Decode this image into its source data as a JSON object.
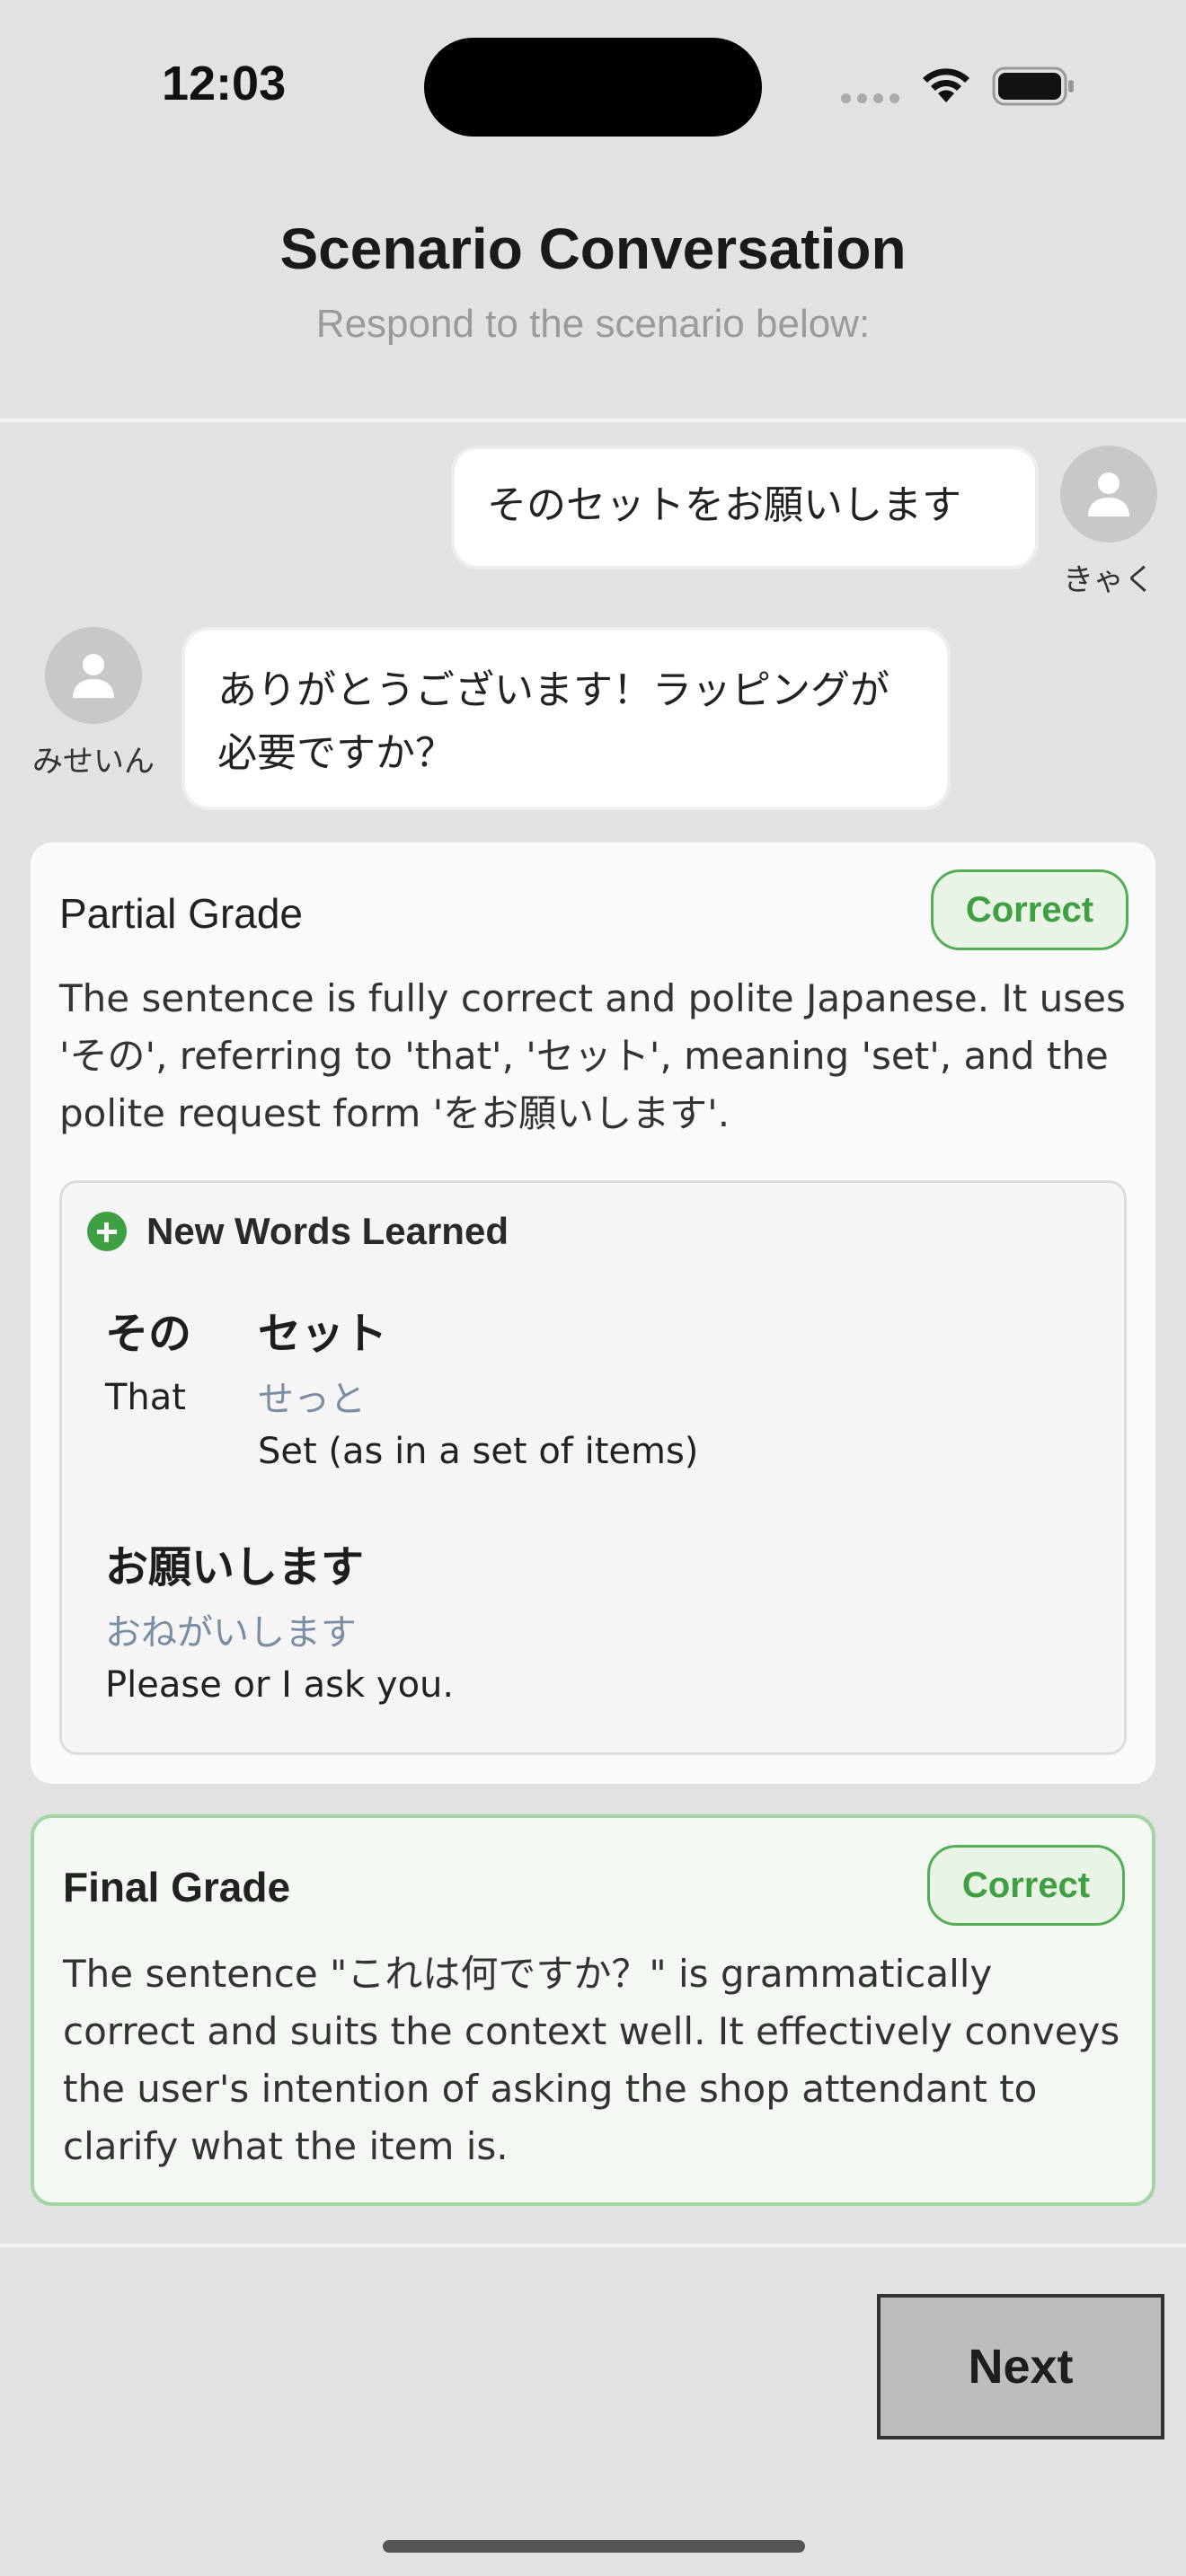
{
  "status": {
    "time": "12:03",
    "icons": [
      "cellular-dots-icon",
      "wifi-icon",
      "battery-icon"
    ]
  },
  "header": {
    "title": "Scenario Conversation",
    "subtitle": "Respond to the scenario below:"
  },
  "conversation": [
    {
      "speaker": "きゃく",
      "text": "そのセットをお願いします",
      "side": "right"
    },
    {
      "speaker": "みせいん",
      "text": "ありがとうございます！ラッピングが必要ですか？",
      "side": "left"
    }
  ],
  "partial_grade": {
    "title": "Partial Grade",
    "badge": "Correct",
    "text": "The sentence is fully correct and polite Japanese. It uses 'その', referring to 'that', 'セット', meaning 'set', and the polite request form 'をお願いします'.",
    "new_words_title": "New Words Learned",
    "words": [
      {
        "word": "その",
        "reading": "",
        "meaning": "That"
      },
      {
        "word": "セット",
        "reading": "せっと",
        "meaning": "Set (as in a set of items)"
      },
      {
        "word": "お願いします",
        "reading": "おねがいします",
        "meaning": "Please or I ask you."
      }
    ]
  },
  "final_grade": {
    "title": "Final Grade",
    "badge": "Correct",
    "text": "The sentence \"これは何ですか？\" is grammatically correct and suits the context well. It effectively conveys the user's intention of asking the shop attendant to clarify what the item is."
  },
  "footer": {
    "next_label": "Next"
  },
  "colors": {
    "background": "#e2e2e2",
    "correct_green": "#3fa043",
    "reading_blue": "#7a8da3"
  }
}
